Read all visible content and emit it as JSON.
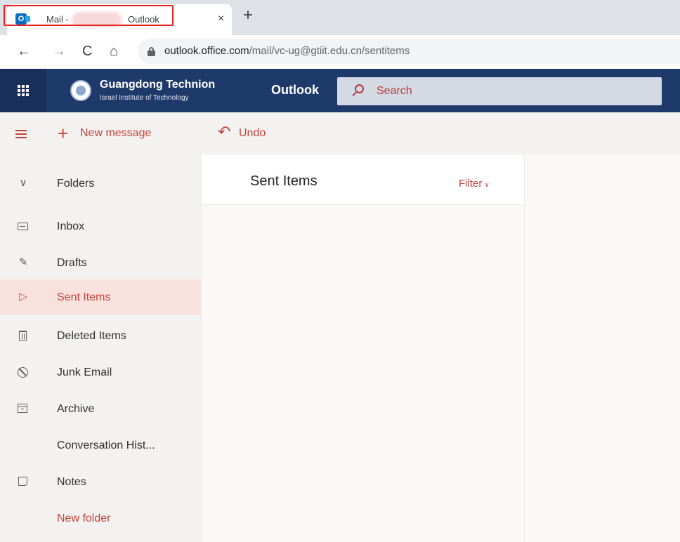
{
  "browser": {
    "tab": {
      "title_left": "Mail -",
      "title_right": "Outlook",
      "close_glyph": "×",
      "favicon": "O",
      "favicon_icon": "outlook-icon"
    },
    "new_tab_glyph": "+",
    "nav": {
      "back": "←",
      "forward": "→",
      "reload": "C",
      "home": "⌂"
    },
    "url_host": "outlook.office.com",
    "url_path": "/mail/vc-ug@gtiit.edu.cn/sentitems",
    "colors": {
      "tab_highlight": "#e6231f"
    }
  },
  "suite_header": {
    "org_name": "Guangdong Technion",
    "org_subtitle": "Israel Institute of Technology",
    "app_name": "Outlook",
    "search_placeholder": "Search",
    "colors": {
      "bar": "#1e3a6b",
      "waffle": "#172f5a"
    }
  },
  "command_bar": {
    "new_message_label": "New message",
    "undo_label": "Undo",
    "undo_glyph": "↶",
    "plus_glyph": "+"
  },
  "folder_pane": {
    "header_label": "Folders",
    "header_glyph": "∨",
    "items": [
      {
        "label": "Inbox",
        "icon": "inbox-icon"
      },
      {
        "label": "Drafts",
        "icon": "pencil-icon",
        "glyph": "✎"
      },
      {
        "label": "Sent Items",
        "icon": "send-icon",
        "glyph": "▷",
        "selected": true
      },
      {
        "label": "Deleted Items",
        "icon": "trash-icon"
      },
      {
        "label": "Junk Email",
        "icon": "block-icon"
      },
      {
        "label": "Archive",
        "icon": "archive-icon"
      },
      {
        "label": "Conversation Hist...",
        "icon": ""
      },
      {
        "label": "Notes",
        "icon": "note-icon"
      }
    ],
    "new_folder_label": "New folder"
  },
  "message_list": {
    "title": "Sent Items",
    "filter_label": "Filter",
    "filter_glyph": "∨"
  },
  "theme": {
    "accent": "#c4443a",
    "selected_bg": "#f9e2de",
    "pane_bg": "#f3f2f1"
  }
}
